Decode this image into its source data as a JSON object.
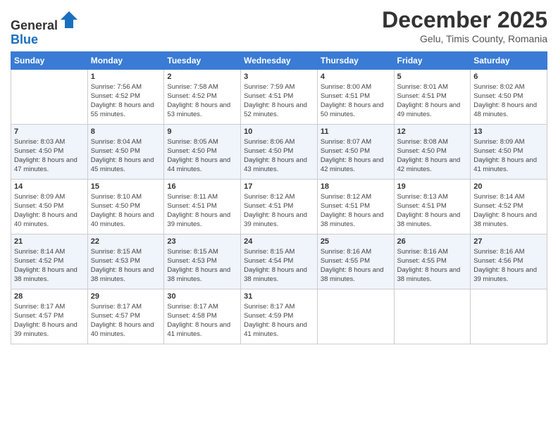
{
  "header": {
    "logo_line1": "General",
    "logo_line2": "Blue",
    "month": "December 2025",
    "location": "Gelu, Timis County, Romania"
  },
  "weekdays": [
    "Sunday",
    "Monday",
    "Tuesday",
    "Wednesday",
    "Thursday",
    "Friday",
    "Saturday"
  ],
  "weeks": [
    [
      {
        "day": "",
        "sunrise": "",
        "sunset": "",
        "daylight": ""
      },
      {
        "day": "1",
        "sunrise": "7:56 AM",
        "sunset": "4:52 PM",
        "daylight": "8 hours and 55 minutes."
      },
      {
        "day": "2",
        "sunrise": "7:58 AM",
        "sunset": "4:52 PM",
        "daylight": "8 hours and 53 minutes."
      },
      {
        "day": "3",
        "sunrise": "7:59 AM",
        "sunset": "4:51 PM",
        "daylight": "8 hours and 52 minutes."
      },
      {
        "day": "4",
        "sunrise": "8:00 AM",
        "sunset": "4:51 PM",
        "daylight": "8 hours and 50 minutes."
      },
      {
        "day": "5",
        "sunrise": "8:01 AM",
        "sunset": "4:51 PM",
        "daylight": "8 hours and 49 minutes."
      },
      {
        "day": "6",
        "sunrise": "8:02 AM",
        "sunset": "4:50 PM",
        "daylight": "8 hours and 48 minutes."
      }
    ],
    [
      {
        "day": "7",
        "sunrise": "8:03 AM",
        "sunset": "4:50 PM",
        "daylight": "8 hours and 47 minutes."
      },
      {
        "day": "8",
        "sunrise": "8:04 AM",
        "sunset": "4:50 PM",
        "daylight": "8 hours and 45 minutes."
      },
      {
        "day": "9",
        "sunrise": "8:05 AM",
        "sunset": "4:50 PM",
        "daylight": "8 hours and 44 minutes."
      },
      {
        "day": "10",
        "sunrise": "8:06 AM",
        "sunset": "4:50 PM",
        "daylight": "8 hours and 43 minutes."
      },
      {
        "day": "11",
        "sunrise": "8:07 AM",
        "sunset": "4:50 PM",
        "daylight": "8 hours and 42 minutes."
      },
      {
        "day": "12",
        "sunrise": "8:08 AM",
        "sunset": "4:50 PM",
        "daylight": "8 hours and 42 minutes."
      },
      {
        "day": "13",
        "sunrise": "8:09 AM",
        "sunset": "4:50 PM",
        "daylight": "8 hours and 41 minutes."
      }
    ],
    [
      {
        "day": "14",
        "sunrise": "8:09 AM",
        "sunset": "4:50 PM",
        "daylight": "8 hours and 40 minutes."
      },
      {
        "day": "15",
        "sunrise": "8:10 AM",
        "sunset": "4:50 PM",
        "daylight": "8 hours and 40 minutes."
      },
      {
        "day": "16",
        "sunrise": "8:11 AM",
        "sunset": "4:51 PM",
        "daylight": "8 hours and 39 minutes."
      },
      {
        "day": "17",
        "sunrise": "8:12 AM",
        "sunset": "4:51 PM",
        "daylight": "8 hours and 39 minutes."
      },
      {
        "day": "18",
        "sunrise": "8:12 AM",
        "sunset": "4:51 PM",
        "daylight": "8 hours and 38 minutes."
      },
      {
        "day": "19",
        "sunrise": "8:13 AM",
        "sunset": "4:51 PM",
        "daylight": "8 hours and 38 minutes."
      },
      {
        "day": "20",
        "sunrise": "8:14 AM",
        "sunset": "4:52 PM",
        "daylight": "8 hours and 38 minutes."
      }
    ],
    [
      {
        "day": "21",
        "sunrise": "8:14 AM",
        "sunset": "4:52 PM",
        "daylight": "8 hours and 38 minutes."
      },
      {
        "day": "22",
        "sunrise": "8:15 AM",
        "sunset": "4:53 PM",
        "daylight": "8 hours and 38 minutes."
      },
      {
        "day": "23",
        "sunrise": "8:15 AM",
        "sunset": "4:53 PM",
        "daylight": "8 hours and 38 minutes."
      },
      {
        "day": "24",
        "sunrise": "8:15 AM",
        "sunset": "4:54 PM",
        "daylight": "8 hours and 38 minutes."
      },
      {
        "day": "25",
        "sunrise": "8:16 AM",
        "sunset": "4:55 PM",
        "daylight": "8 hours and 38 minutes."
      },
      {
        "day": "26",
        "sunrise": "8:16 AM",
        "sunset": "4:55 PM",
        "daylight": "8 hours and 38 minutes."
      },
      {
        "day": "27",
        "sunrise": "8:16 AM",
        "sunset": "4:56 PM",
        "daylight": "8 hours and 39 minutes."
      }
    ],
    [
      {
        "day": "28",
        "sunrise": "8:17 AM",
        "sunset": "4:57 PM",
        "daylight": "8 hours and 39 minutes."
      },
      {
        "day": "29",
        "sunrise": "8:17 AM",
        "sunset": "4:57 PM",
        "daylight": "8 hours and 40 minutes."
      },
      {
        "day": "30",
        "sunrise": "8:17 AM",
        "sunset": "4:58 PM",
        "daylight": "8 hours and 41 minutes."
      },
      {
        "day": "31",
        "sunrise": "8:17 AM",
        "sunset": "4:59 PM",
        "daylight": "8 hours and 41 minutes."
      },
      {
        "day": "",
        "sunrise": "",
        "sunset": "",
        "daylight": ""
      },
      {
        "day": "",
        "sunrise": "",
        "sunset": "",
        "daylight": ""
      },
      {
        "day": "",
        "sunrise": "",
        "sunset": "",
        "daylight": ""
      }
    ]
  ]
}
